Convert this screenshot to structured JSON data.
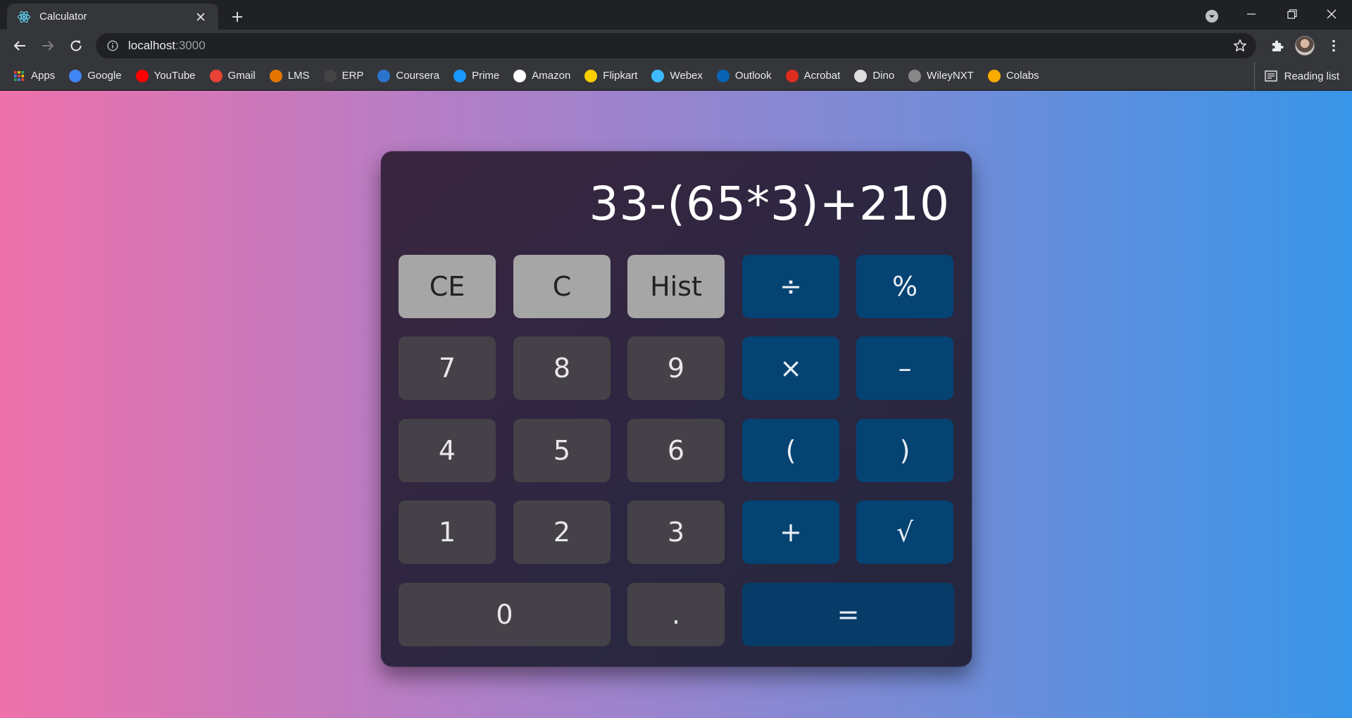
{
  "browser": {
    "tab_title": "Calculator",
    "address_host": "localhost",
    "address_port": ":3000",
    "bookmarks": [
      {
        "label": "Apps",
        "icon": "apps-grid-icon",
        "color": "#ea4335"
      },
      {
        "label": "Google",
        "icon": "google-icon",
        "color": "#4285f4"
      },
      {
        "label": "YouTube",
        "icon": "youtube-icon",
        "color": "#ff0000"
      },
      {
        "label": "Gmail",
        "icon": "gmail-icon",
        "color": "#ea4335"
      },
      {
        "label": "LMS",
        "icon": "lms-icon",
        "color": "#e37400"
      },
      {
        "label": "ERP",
        "icon": "erp-icon",
        "color": "#444444"
      },
      {
        "label": "Coursera",
        "icon": "coursera-icon",
        "color": "#2a73cc"
      },
      {
        "label": "Prime",
        "icon": "prime-video-icon",
        "color": "#1a98ff"
      },
      {
        "label": "Amazon",
        "icon": "amazon-icon",
        "color": "#ffffff"
      },
      {
        "label": "Flipkart",
        "icon": "flipkart-icon",
        "color": "#f8d000"
      },
      {
        "label": "Webex",
        "icon": "webex-icon",
        "color": "#3dbaff"
      },
      {
        "label": "Outlook",
        "icon": "outlook-icon",
        "color": "#0a64b4"
      },
      {
        "label": "Acrobat",
        "icon": "acrobat-icon",
        "color": "#e02c1f"
      },
      {
        "label": "Dino",
        "icon": "dino-icon",
        "color": "#dddddd"
      },
      {
        "label": "WileyNXT",
        "icon": "wileynxt-icon",
        "color": "#888888"
      },
      {
        "label": "Colabs",
        "icon": "colab-icon",
        "color": "#f9ab00"
      }
    ],
    "reading_list": "Reading list"
  },
  "calculator": {
    "display": "33-(65*3)+210",
    "keys": [
      {
        "label": "CE",
        "kind": "func",
        "name": "clear-entry-button"
      },
      {
        "label": "C",
        "kind": "func",
        "name": "clear-button"
      },
      {
        "label": "Hist",
        "kind": "func",
        "name": "history-button"
      },
      {
        "label": "÷",
        "kind": "op",
        "name": "divide-button"
      },
      {
        "label": "%",
        "kind": "op",
        "name": "percent-button"
      },
      {
        "label": "7",
        "kind": "num",
        "name": "digit-7-button"
      },
      {
        "label": "8",
        "kind": "num",
        "name": "digit-8-button"
      },
      {
        "label": "9",
        "kind": "num",
        "name": "digit-9-button"
      },
      {
        "label": "×",
        "kind": "op",
        "name": "multiply-button"
      },
      {
        "label": "–",
        "kind": "op",
        "name": "subtract-button"
      },
      {
        "label": "4",
        "kind": "num",
        "name": "digit-4-button"
      },
      {
        "label": "5",
        "kind": "num",
        "name": "digit-5-button"
      },
      {
        "label": "6",
        "kind": "num",
        "name": "digit-6-button"
      },
      {
        "label": "(",
        "kind": "op",
        "name": "open-paren-button"
      },
      {
        "label": ")",
        "kind": "op",
        "name": "close-paren-button"
      },
      {
        "label": "1",
        "kind": "num",
        "name": "digit-1-button"
      },
      {
        "label": "2",
        "kind": "num",
        "name": "digit-2-button"
      },
      {
        "label": "3",
        "kind": "num",
        "name": "digit-3-button"
      },
      {
        "label": "+",
        "kind": "op",
        "name": "add-button"
      },
      {
        "label": "√",
        "kind": "op",
        "name": "sqrt-button"
      },
      {
        "label": "0",
        "kind": "num",
        "name": "digit-0-button"
      },
      {
        "label": ".",
        "kind": "num",
        "name": "decimal-button"
      },
      {
        "label": "=",
        "kind": "eq",
        "name": "equals-button"
      }
    ]
  },
  "colors": {
    "func_key": "#a6a6a6",
    "num_key": "#454148",
    "op_key": "#054373",
    "gradient_left": "#ee71ab",
    "gradient_right": "#3895e8"
  }
}
